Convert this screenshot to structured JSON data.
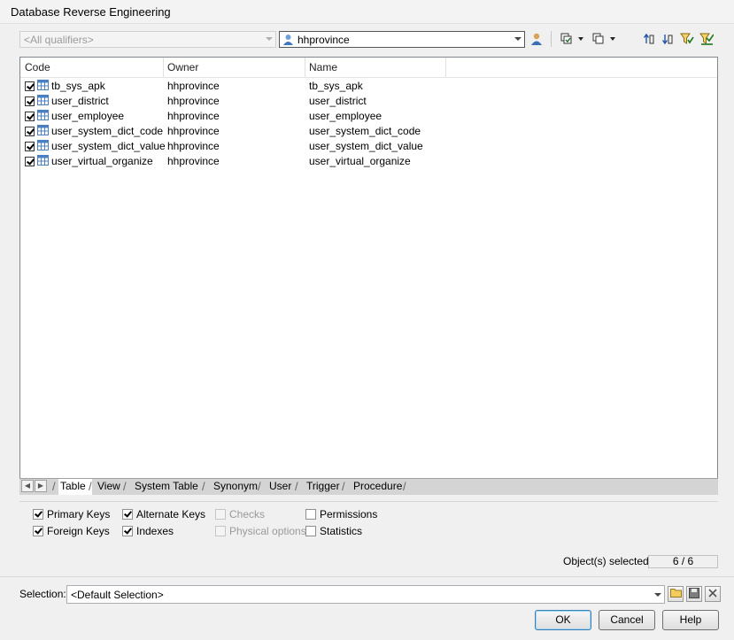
{
  "window": {
    "title": "Database Reverse Engineering"
  },
  "toolbar": {
    "qualifier_placeholder": "<All qualifiers>",
    "owner_value": "hhprovince",
    "icons": [
      "select-user-icon",
      "select-all-icon",
      "deselect-all-icon",
      "move-up-icon",
      "move-down-icon",
      "filter-icon",
      "filter-check-icon"
    ]
  },
  "grid": {
    "columns": [
      "Code",
      "Owner",
      "Name"
    ],
    "rows": [
      {
        "code": "tb_sys_apk",
        "owner": "hhprovince",
        "name": "tb_sys_apk",
        "checked": true
      },
      {
        "code": "user_district",
        "owner": "hhprovince",
        "name": "user_district",
        "checked": true
      },
      {
        "code": "user_employee",
        "owner": "hhprovince",
        "name": "user_employee",
        "checked": true
      },
      {
        "code": "user_system_dict_code",
        "owner": "hhprovince",
        "name": "user_system_dict_code",
        "checked": true
      },
      {
        "code": "user_system_dict_value",
        "owner": "hhprovince",
        "name": "user_system_dict_value",
        "checked": true
      },
      {
        "code": "user_virtual_organize",
        "owner": "hhprovince",
        "name": "user_virtual_organize",
        "checked": true
      }
    ]
  },
  "tabs": [
    "Table",
    "View",
    "System Table",
    "Synonym",
    "User",
    "Trigger",
    "Procedure"
  ],
  "options": [
    {
      "label": "Primary Keys",
      "checked": true,
      "enabled": true
    },
    {
      "label": "Alternate Keys",
      "checked": true,
      "enabled": true
    },
    {
      "label": "Checks",
      "checked": false,
      "enabled": false
    },
    {
      "label": "Permissions",
      "checked": false,
      "enabled": true
    },
    {
      "label": "Foreign Keys",
      "checked": true,
      "enabled": true
    },
    {
      "label": "Indexes",
      "checked": true,
      "enabled": true
    },
    {
      "label": "Physical options",
      "checked": false,
      "enabled": false
    },
    {
      "label": "Statistics",
      "checked": false,
      "enabled": true
    }
  ],
  "status": {
    "label": "Object(s) selected:",
    "count": "6 / 6"
  },
  "selection": {
    "label": "Selection:",
    "value": "<Default Selection>"
  },
  "buttons": {
    "ok": "OK",
    "cancel": "Cancel",
    "help": "Help"
  },
  "colors": {
    "accent": "#3c7fb1",
    "grid_border": "#828790",
    "table_icon": "#4a7fc1"
  }
}
